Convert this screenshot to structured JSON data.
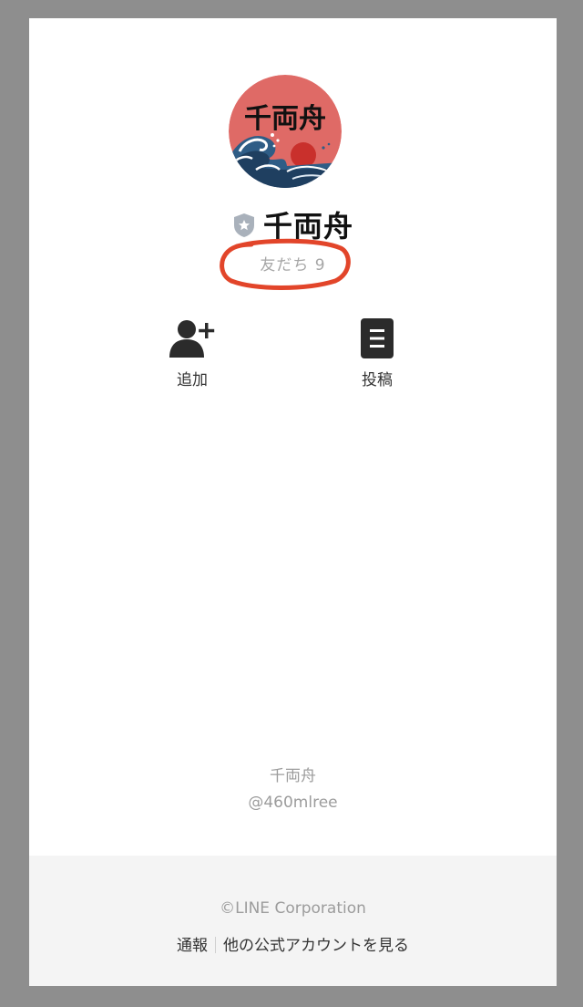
{
  "profile": {
    "logo_text": "千両舟",
    "name": "千両舟",
    "friends_label": "友だち 9",
    "verified_badge": "shield-star-icon",
    "highlight_color": "#e2452a",
    "avatar_bg": "#df6a66"
  },
  "actions": {
    "add_label": "追加",
    "post_label": "投稿"
  },
  "footer": {
    "name": "千両舟",
    "account_id": "@460mlree",
    "copyright": "©LINE Corporation",
    "report_link": "通報",
    "other_accounts_link": "他の公式アカウントを見る"
  }
}
